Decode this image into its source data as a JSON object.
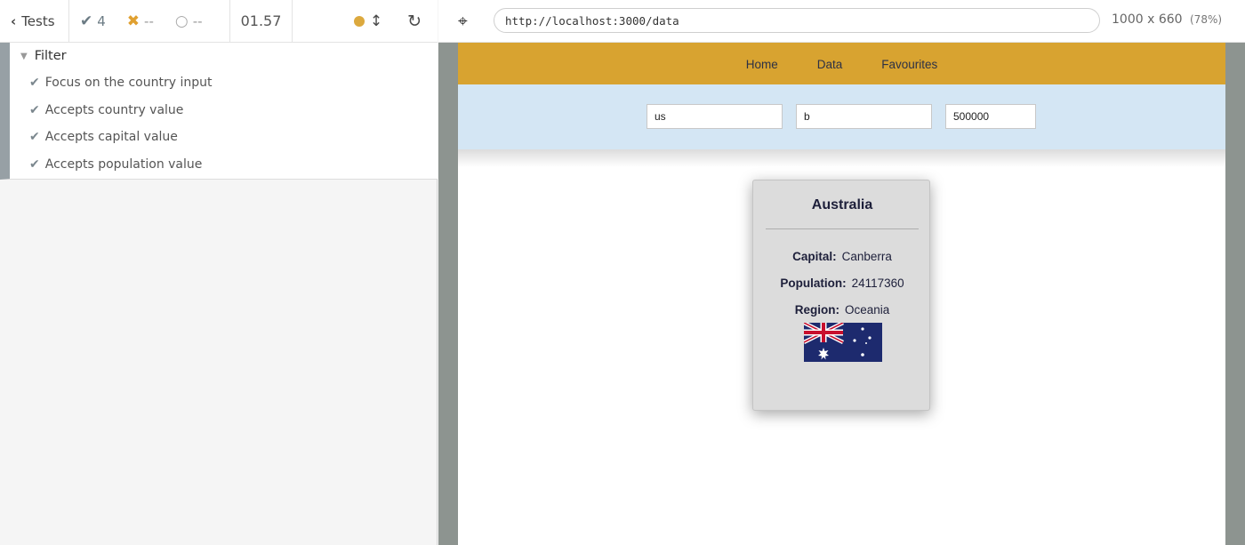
{
  "reporter": {
    "back_label": "Tests",
    "stats": {
      "passed": "4",
      "failed": "--",
      "pending": "--"
    },
    "duration": "01.57",
    "suite": {
      "title": "Filter",
      "tests": [
        "Focus on the country input",
        "Accepts country value",
        "Accepts capital value",
        "Accepts population value"
      ]
    }
  },
  "aut": {
    "url": "http://localhost:3000/data",
    "viewport": "1000 x 660",
    "zoom": "(78%)"
  },
  "app": {
    "nav": [
      "Home",
      "Data",
      "Favourites"
    ],
    "filters": {
      "country": "us",
      "capital": "b",
      "population": "500000"
    },
    "card": {
      "name": "Australia",
      "capital_label": "Capital:",
      "capital": "Canberra",
      "population_label": "Population:",
      "population": "24117360",
      "region_label": "Region:",
      "region": "Oceania"
    }
  },
  "colors": {
    "navbar": "#d8a330",
    "filter_bar": "#d4e6f4",
    "card": "#dcdcdc",
    "flag_blue": "#1d2a6e",
    "running_dot": "#dca93e"
  },
  "icons": [
    "chevron-left-icon",
    "check-icon",
    "x-icon",
    "spinner-icon",
    "running-dot-icon",
    "resize-icon",
    "reload-icon",
    "crosshair-icon",
    "triangle-down-icon"
  ]
}
